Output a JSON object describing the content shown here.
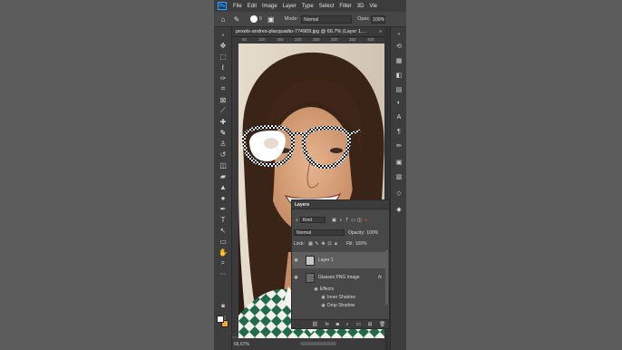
{
  "menubar": {
    "logo": "Ps",
    "items": [
      "File",
      "Edit",
      "Image",
      "Layer",
      "Type",
      "Select",
      "Filter",
      "3D",
      "Vie"
    ]
  },
  "options": {
    "mode_label": "Mode:",
    "mode_value": "Normal",
    "opacity_label": "Opac",
    "opacity_value": "100%",
    "brush_size": "9"
  },
  "document": {
    "tab_title": "pexels-andres-placquadio-774909.jpg @ 66.7% (Layer 1,...",
    "zoom": "66.67%",
    "ruler_labels": [
      "50",
      "100",
      "150",
      "200",
      "250",
      "300",
      "350",
      "400"
    ]
  },
  "layers_panel": {
    "title": "Layers",
    "filter_kind": "Kind",
    "blend_mode": "Normal",
    "opacity_label": "Opacity:",
    "opacity_value": "100%",
    "lock_label": "Lock:",
    "fill_label": "Fill:",
    "fill_value": "100%",
    "layers": [
      {
        "name": "Layer 1",
        "selected": true
      },
      {
        "name": "Glasses PNG Image",
        "fx": "fx"
      }
    ],
    "effects_label": "Effects",
    "effects": [
      "Inner Shadow",
      "Drop Shadow"
    ]
  },
  "colors": {
    "foreground": "#ffffff",
    "background": "#f2a733",
    "selection_highlight": "#5f5f5f"
  }
}
